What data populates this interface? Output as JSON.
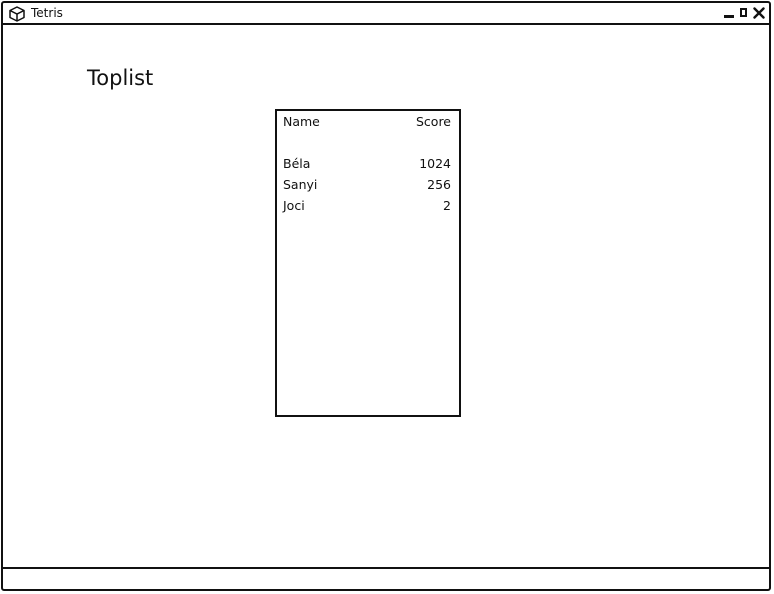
{
  "window": {
    "title": "Tetris",
    "controls": {
      "minimize": "minimize",
      "maximize": "maximize",
      "close": "close"
    }
  },
  "page": {
    "title": "Toplist"
  },
  "toplist": {
    "headers": {
      "name": "Name",
      "score": "Score"
    },
    "rows": [
      {
        "name": "Béla",
        "score": "1024"
      },
      {
        "name": "Sanyi",
        "score": "256"
      },
      {
        "name": "Joci",
        "score": "2"
      }
    ]
  }
}
